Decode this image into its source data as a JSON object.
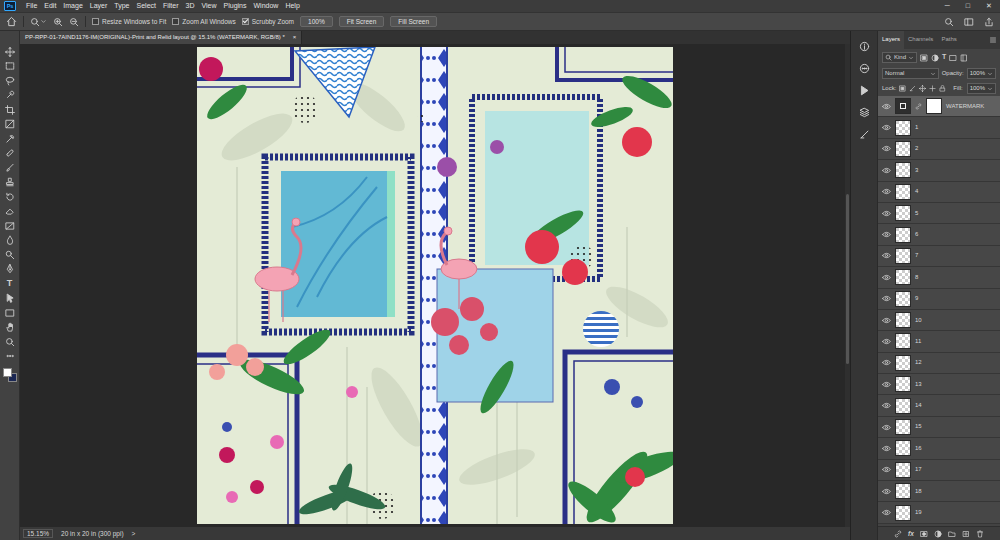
{
  "app": {
    "logo": "Ps"
  },
  "menu": [
    "File",
    "Edit",
    "Image",
    "Layer",
    "Type",
    "Select",
    "Filter",
    "3D",
    "View",
    "Plugins",
    "Window",
    "Help"
  ],
  "window_controls": [
    "─",
    "□",
    "✕"
  ],
  "options_bar": {
    "checkboxes": [
      {
        "label": "Resize Windows to Fit",
        "checked": false
      },
      {
        "label": "Zoom All Windows",
        "checked": false
      },
      {
        "label": "Scrubby Zoom",
        "checked": true
      }
    ],
    "buttons": [
      "100%",
      "Fit Screen",
      "Fill Screen"
    ]
  },
  "toolbar": {
    "type_tool": "T"
  },
  "document": {
    "title": "PP-RPP-01-7AIND1176-IM(ORIGINAL)-Print and Relid layout @ 15.1% (WATERMARK, RGB/8) *",
    "close": "×"
  },
  "status_bar": {
    "zoom": "15.15%",
    "info": "20 in x 20 in (300 ppi)",
    "arrow": ">"
  },
  "layers_panel": {
    "tabs": [
      {
        "label": "Layers",
        "selected": true
      },
      {
        "label": "Channels",
        "selected": false
      },
      {
        "label": "Paths",
        "selected": false
      }
    ],
    "filter": "Kind",
    "type_filter": "T",
    "blend_mode": "Normal",
    "opacity_label": "Opacity:",
    "opacity": "100%",
    "lock_label": "Lock:",
    "fill_label": "Fill:",
    "fill": "100%",
    "fx": "fx",
    "layers": [
      {
        "name": "WATERMARK",
        "visible": true,
        "selected": true,
        "kind": "masked"
      },
      {
        "name": "1",
        "visible": true,
        "selected": false,
        "kind": "pixel"
      },
      {
        "name": "2",
        "visible": true,
        "selected": false,
        "kind": "pixel"
      },
      {
        "name": "3",
        "visible": true,
        "selected": false,
        "kind": "pixel"
      },
      {
        "name": "4",
        "visible": true,
        "selected": false,
        "kind": "pixel"
      },
      {
        "name": "5",
        "visible": true,
        "selected": false,
        "kind": "pixel"
      },
      {
        "name": "6",
        "visible": true,
        "selected": false,
        "kind": "pixel"
      },
      {
        "name": "7",
        "visible": true,
        "selected": false,
        "kind": "pixel"
      },
      {
        "name": "8",
        "visible": true,
        "selected": false,
        "kind": "pixel"
      },
      {
        "name": "9",
        "visible": true,
        "selected": false,
        "kind": "pixel"
      },
      {
        "name": "10",
        "visible": true,
        "selected": false,
        "kind": "pixel"
      },
      {
        "name": "11",
        "visible": true,
        "selected": false,
        "kind": "pixel"
      },
      {
        "name": "12",
        "visible": true,
        "selected": false,
        "kind": "pixel"
      },
      {
        "name": "13",
        "visible": true,
        "selected": false,
        "kind": "pixel"
      },
      {
        "name": "14",
        "visible": true,
        "selected": false,
        "kind": "pixel"
      },
      {
        "name": "15",
        "visible": true,
        "selected": false,
        "kind": "pixel"
      },
      {
        "name": "16",
        "visible": true,
        "selected": false,
        "kind": "pixel"
      },
      {
        "name": "17",
        "visible": true,
        "selected": false,
        "kind": "pixel"
      },
      {
        "name": "18",
        "visible": true,
        "selected": false,
        "kind": "pixel"
      },
      {
        "name": "19",
        "visible": true,
        "selected": false,
        "kind": "pixel"
      }
    ]
  }
}
